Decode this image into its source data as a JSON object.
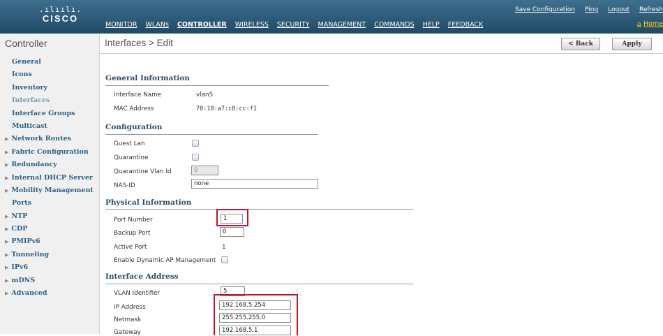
{
  "header": {
    "logo_bars": ".ılıılı.",
    "logo_text": "CISCO",
    "nav": [
      "MONITOR",
      "WLANs",
      "CONTROLLER",
      "WIRELESS",
      "SECURITY",
      "MANAGEMENT",
      "COMMANDS",
      "HELP",
      "FEEDBACK"
    ],
    "active_nav": "CONTROLLER",
    "utility": [
      "Save Configuration",
      "Ping",
      "Logout",
      "Refresh"
    ],
    "home": "Home"
  },
  "sidebar": {
    "title": "Controller",
    "items": [
      {
        "label": "General",
        "expandable": false
      },
      {
        "label": "Icons",
        "expandable": false
      },
      {
        "label": "Inventory",
        "expandable": false
      },
      {
        "label": "Interfaces",
        "expandable": false,
        "current": true
      },
      {
        "label": "Interface Groups",
        "expandable": false
      },
      {
        "label": "Multicast",
        "expandable": false
      },
      {
        "label": "Network Routes",
        "expandable": true
      },
      {
        "label": "Fabric Configuration",
        "expandable": true
      },
      {
        "label": "Redundancy",
        "expandable": true
      },
      {
        "label": "Internal DHCP Server",
        "expandable": true
      },
      {
        "label": "Mobility Management",
        "expandable": true
      },
      {
        "label": "Ports",
        "expandable": false
      },
      {
        "label": "NTP",
        "expandable": true
      },
      {
        "label": "CDP",
        "expandable": true
      },
      {
        "label": "PMIPv6",
        "expandable": true
      },
      {
        "label": "Tunneling",
        "expandable": true
      },
      {
        "label": "IPv6",
        "expandable": true
      },
      {
        "label": "mDNS",
        "expandable": true
      },
      {
        "label": "Advanced",
        "expandable": true
      }
    ]
  },
  "page": {
    "title": "Interfaces > Edit",
    "back_label": "< Back",
    "apply_label": "Apply"
  },
  "general": {
    "heading": "General Information",
    "interface_name_label": "Interface Name",
    "interface_name": "vlan5",
    "mac_label": "MAC Address",
    "mac": "70:18:a7:c8:cc:f1"
  },
  "configuration": {
    "heading": "Configuration",
    "guest_lan_label": "Guest Lan",
    "quarantine_label": "Quarantine",
    "quarantine_vlan_label": "Quarantine Vlan Id",
    "quarantine_vlan_value": "0",
    "nas_id_label": "NAS-ID",
    "nas_id_value": "none"
  },
  "physical": {
    "heading": "Physical Information",
    "port_number_label": "Port Number",
    "port_number": "1",
    "backup_port_label": "Backup Port",
    "backup_port": "0",
    "active_port_label": "Active Port",
    "active_port": "1",
    "dynamic_ap_label": "Enable Dynamic AP Management"
  },
  "address": {
    "heading": "Interface Address",
    "vlan_id_label": "VLAN Identifier",
    "vlan_id": "5",
    "ip_label": "IP Address",
    "ip": "192.168.5.254",
    "netmask_label": "Netmask",
    "netmask": "255.255.255.0",
    "gateway_label": "Gateway",
    "gateway": "192.168.5.1"
  }
}
